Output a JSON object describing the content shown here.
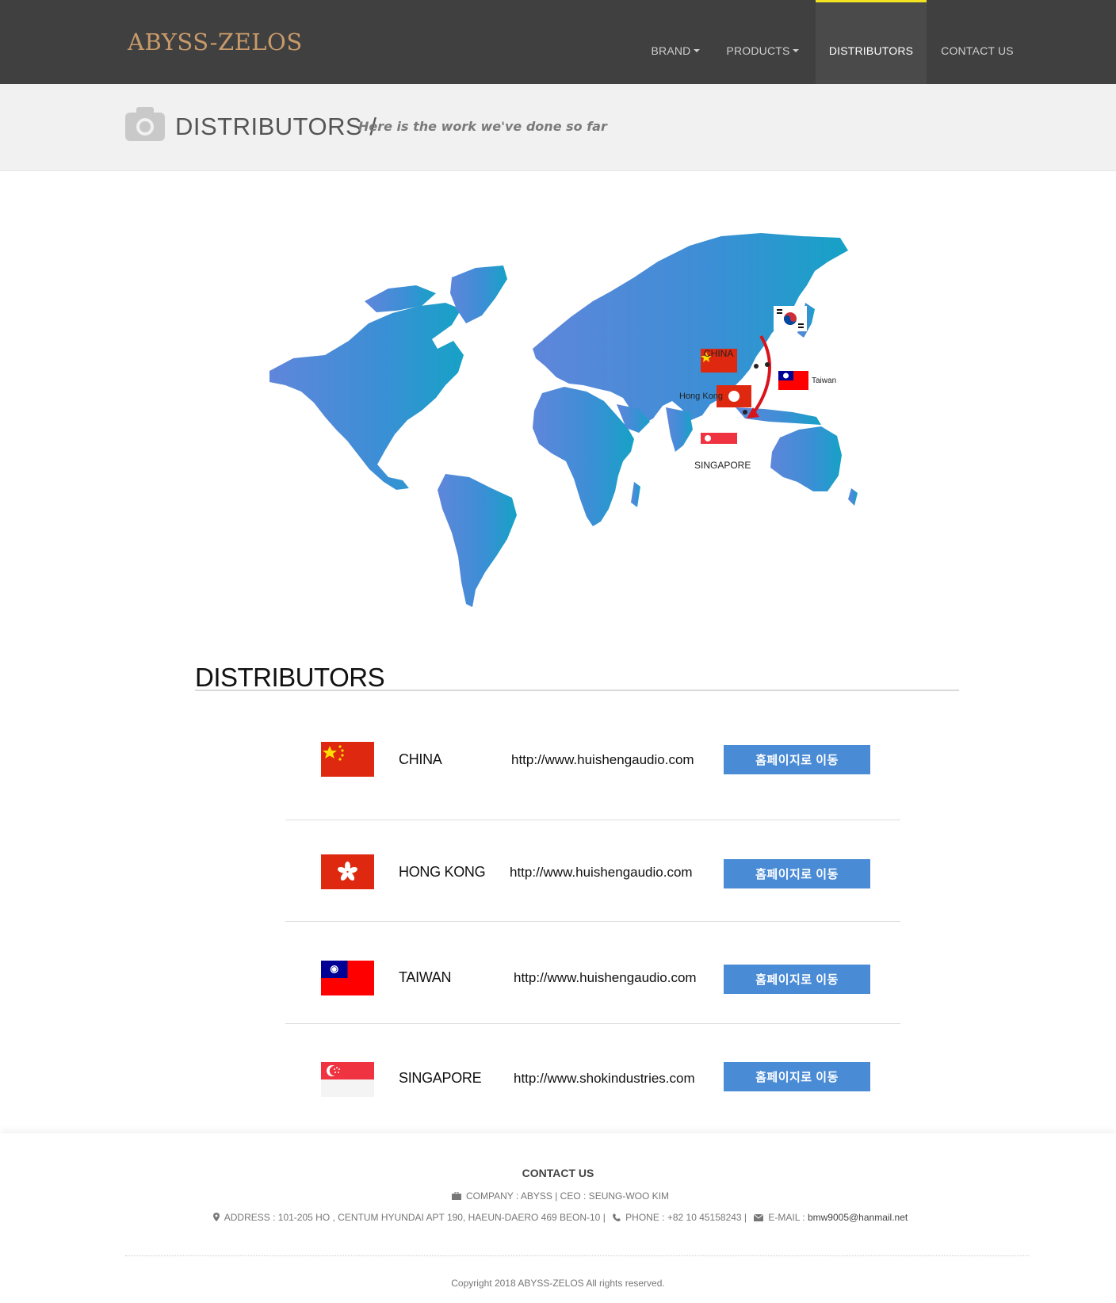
{
  "header": {
    "brand": "ABYSS-ZELOS",
    "nav": [
      {
        "label": "BRAND",
        "dropdown": true
      },
      {
        "label": "PRODUCTS",
        "dropdown": true
      },
      {
        "label": "DISTRIBUTORS",
        "active": true
      },
      {
        "label": "CONTACT US"
      }
    ]
  },
  "titlebar": {
    "icon": "camera-icon",
    "title": "DISTRIBUTORS /",
    "subtitle": "Here is the work we've done so far"
  },
  "map": {
    "labels": {
      "china": "CHINA",
      "hongkong": "Hong Kong",
      "taiwan": "Taiwan",
      "singapore": "SINGAPORE"
    }
  },
  "distributors": {
    "heading": "DISTRIBUTORS",
    "button_label": "홈페이지로 이동",
    "rows": [
      {
        "country": "CHINA",
        "url": "http://www.huishengaudio.com",
        "flag": "china-flag"
      },
      {
        "country": "HONG KONG",
        "url": "http://www.huishengaudio.com",
        "flag": "hong-kong-flag"
      },
      {
        "country": "TAIWAN",
        "url": "http://www.huishengaudio.com",
        "flag": "taiwan-flag"
      },
      {
        "country": "SINGAPORE",
        "url": "http://www.shokindustries.com",
        "flag": "singapore-flag"
      }
    ]
  },
  "footer": {
    "title": "CONTACT US",
    "company_line": "COMPANY : ABYSS | CEO : SEUNG-WOO KIM",
    "address": "ADDRESS : 101-205 HO , CENTUM HYUNDAI APT 190, HAEUN-DAERO 469 BEON-10 |",
    "phone": "PHONE : +82 10 45158243 |",
    "email_label": "E-MAIL :",
    "email": "bmw9005@hanmail.net",
    "copyright": "Copyright 2018 ABYSS-ZELOS All rights reserved."
  },
  "colors": {
    "nav_bg": "#404040",
    "brand": "#c89a6a",
    "active_bar": "#f3e21f",
    "button": "#4a8bd6",
    "map_left": "#5a82d8",
    "map_right": "#1aa0c8"
  }
}
